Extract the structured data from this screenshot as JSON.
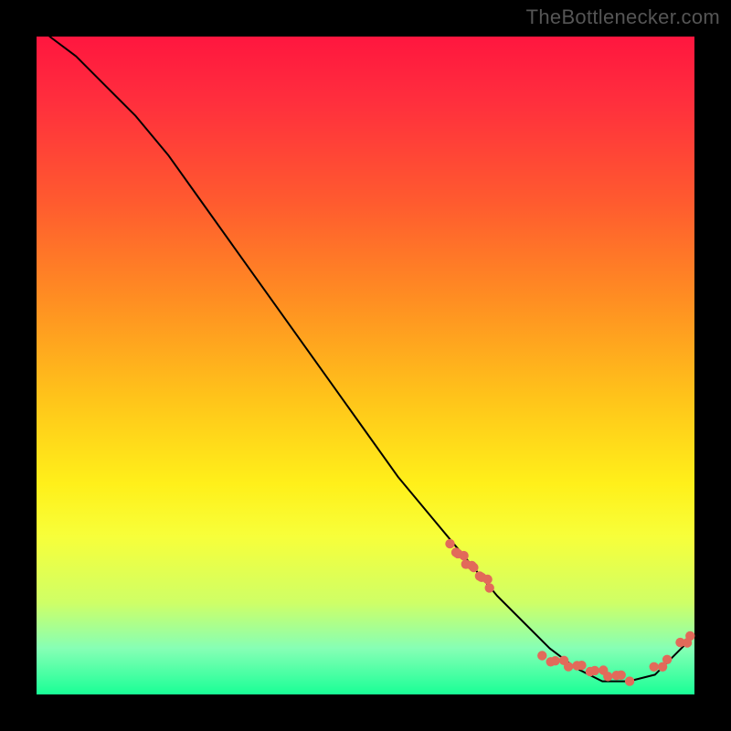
{
  "watermark": "TheBottlenecker.com",
  "chart_data": {
    "type": "line",
    "title": "",
    "xlabel": "",
    "ylabel": "",
    "xlim": [
      0,
      100
    ],
    "ylim": [
      0,
      100
    ],
    "series": [
      {
        "name": "curve",
        "x": [
          2,
          6,
          10,
          15,
          20,
          25,
          30,
          35,
          40,
          45,
          50,
          55,
          60,
          65,
          70,
          75,
          78,
          82,
          86,
          90,
          94,
          97,
          100
        ],
        "y": [
          100,
          97,
          93,
          88,
          82,
          75,
          68,
          61,
          54,
          47,
          40,
          33,
          27,
          21,
          15,
          10,
          7,
          4,
          2,
          2,
          3,
          6,
          9
        ],
        "stroke": "#000000"
      }
    ],
    "marker_clusters": [
      {
        "start_x": 63,
        "end_x": 69,
        "y_start": 22.5,
        "y_end": 16.5,
        "count": 11,
        "color": "#e26a5a"
      },
      {
        "start_x": 77,
        "end_x": 90,
        "y_start": 5.5,
        "y_end": 2.3,
        "count": 14,
        "color": "#e26a5a"
      },
      {
        "start_x": 94,
        "end_x": 96,
        "y_start": 3.8,
        "y_end": 5.2,
        "count": 3,
        "color": "#e26a5a"
      },
      {
        "start_x": 98,
        "end_x": 99.5,
        "y_start": 7.5,
        "y_end": 8.8,
        "count": 3,
        "color": "#e26a5a"
      }
    ],
    "background": {
      "type": "vertical-gradient",
      "stops": [
        {
          "pos": 0.0,
          "color": "#ff163f"
        },
        {
          "pos": 0.55,
          "color": "#ffc41a"
        },
        {
          "pos": 0.76,
          "color": "#f7ff3a"
        },
        {
          "pos": 1.0,
          "color": "#19ff96"
        }
      ]
    }
  }
}
